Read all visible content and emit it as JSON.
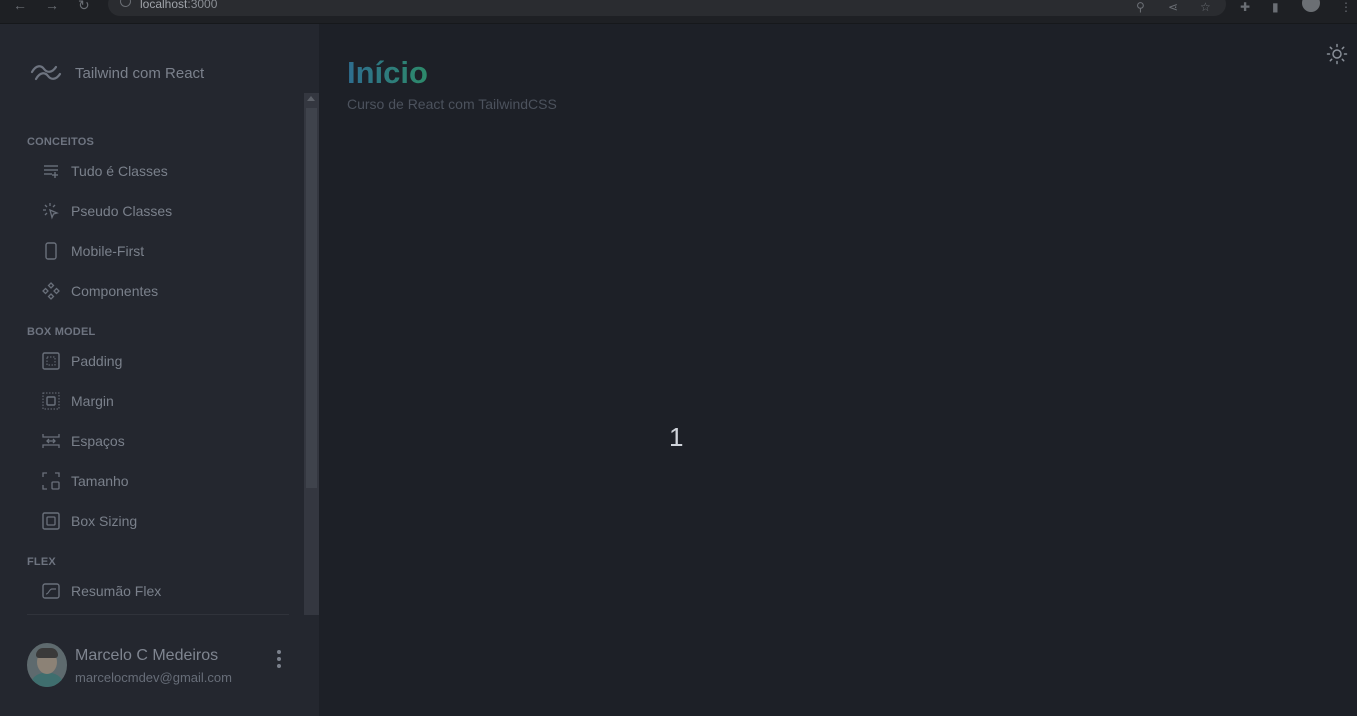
{
  "browser": {
    "url_host": "localhost",
    "url_port": ":3000"
  },
  "sidebar": {
    "brand": "Tailwind com React",
    "sections": [
      {
        "title": "CONCEITOS",
        "items": [
          {
            "label": "Tudo é Classes",
            "icon": "list-icon"
          },
          {
            "label": "Pseudo Classes",
            "icon": "cursor-click-icon"
          },
          {
            "label": "Mobile-First",
            "icon": "phone-icon"
          },
          {
            "label": "Componentes",
            "icon": "components-icon"
          }
        ]
      },
      {
        "title": "BOX MODEL",
        "items": [
          {
            "label": "Padding",
            "icon": "padding-icon"
          },
          {
            "label": "Margin",
            "icon": "margin-icon"
          },
          {
            "label": "Espaços",
            "icon": "spacing-icon"
          },
          {
            "label": "Tamanho",
            "icon": "size-icon"
          },
          {
            "label": "Box Sizing",
            "icon": "box-sizing-icon"
          }
        ]
      },
      {
        "title": "FLEX",
        "items": [
          {
            "label": "Resumão Flex",
            "icon": "flex-icon"
          }
        ]
      }
    ],
    "user": {
      "name": "Marcelo C Medeiros",
      "email": "marcelocmdev@gmail.com"
    }
  },
  "main": {
    "title": "Início",
    "subtitle": "Curso de React com TailwindCSS",
    "content": "1"
  },
  "colors": {
    "background": "#1d2027",
    "sidebar": "#24272f",
    "title_gradient_start": "#2e6d8f",
    "title_gradient_end": "#2d8a6a"
  }
}
